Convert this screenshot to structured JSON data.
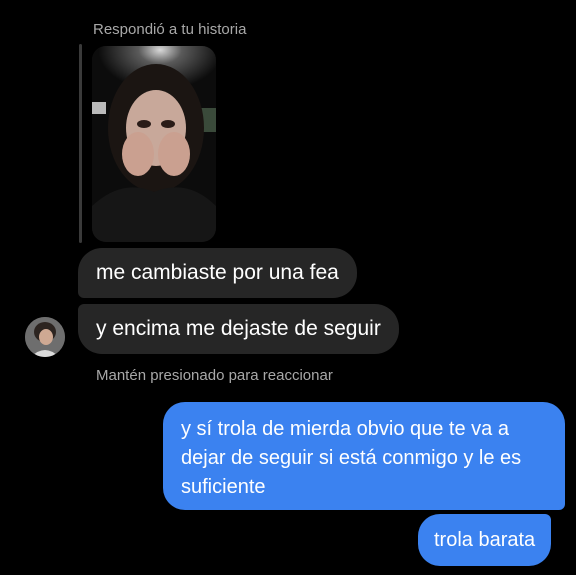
{
  "story_reply": {
    "label": "Respondió a tu historia"
  },
  "incoming": {
    "messages": [
      {
        "text": "me cambiaste por una fea"
      },
      {
        "text": "y encima me dejaste de seguir"
      }
    ]
  },
  "hint": "Mantén presionado para reaccionar",
  "outgoing": {
    "messages": [
      {
        "text": "y sí trola de mierda obvio que te va a dejar de seguir si está conmigo y le es suficiente"
      },
      {
        "text": "trola barata"
      }
    ]
  },
  "colors": {
    "background": "#000000",
    "incoming_bubble": "#262626",
    "outgoing_bubble": "#3b82f0",
    "secondary_text": "#a8a8a8"
  }
}
